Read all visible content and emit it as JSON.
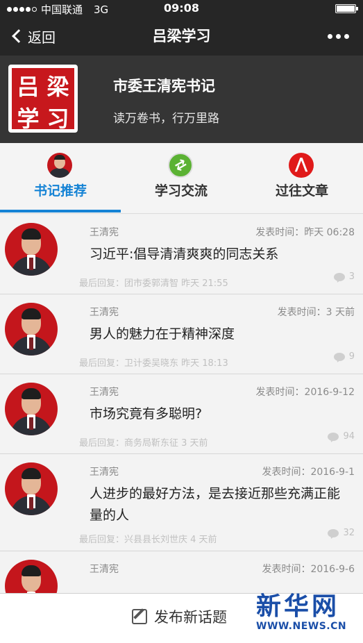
{
  "status_bar": {
    "carrier": "中国联通",
    "network": "3G",
    "time": "09:08"
  },
  "nav": {
    "back_label": "返回",
    "title": "吕梁学习"
  },
  "header": {
    "logo_chars": [
      "吕",
      "梁",
      "学",
      "习"
    ],
    "name": "市委王清宪书记",
    "motto": "读万卷书，行万里路"
  },
  "tabs": [
    {
      "label": "书记推荐",
      "icon": "leader-portrait-icon",
      "active": true
    },
    {
      "label": "学习交流",
      "icon": "study-exchange-icon",
      "active": false
    },
    {
      "label": "过往文章",
      "icon": "past-articles-icon",
      "active": false
    }
  ],
  "posts": [
    {
      "author": "王清宪",
      "time": "发表时间：昨天 06:28",
      "title": "习近平:倡导清清爽爽的同志关系",
      "last_reply": "最后回复：团市委郭清智 昨天 21:55",
      "comments": "3"
    },
    {
      "author": "王清宪",
      "time": "发表时间：3 天前",
      "title": "男人的魅力在于精神深度",
      "last_reply": "最后回复：卫计委吴晓东 昨天 18:13",
      "comments": "9"
    },
    {
      "author": "王清宪",
      "time": "发表时间：2016-9-12",
      "title": "市场究竟有多聪明?",
      "last_reply": "最后回复：商务局靳东征 3 天前",
      "comments": "94"
    },
    {
      "author": "王清宪",
      "time": "发表时间：2016-9-1",
      "title": "人进步的最好方法，是去接近那些充满正能量的人",
      "last_reply": "最后回复：兴县县长刘世庆 4 天前",
      "comments": "32"
    },
    {
      "author": "王清宪",
      "time": "发表时间：2016-9-6",
      "title": "",
      "last_reply": "",
      "comments": ""
    }
  ],
  "bottom_bar": {
    "new_topic_label": "发布新话题"
  },
  "watermark": {
    "brand": "新华网",
    "url": "WWW.NEWS.CN"
  },
  "colors": {
    "accent": "#1583d5",
    "nav_background": "#262626",
    "header_background": "#353535",
    "logo_red": "#c7181d",
    "watermark_blue": "#1a4ea8"
  }
}
